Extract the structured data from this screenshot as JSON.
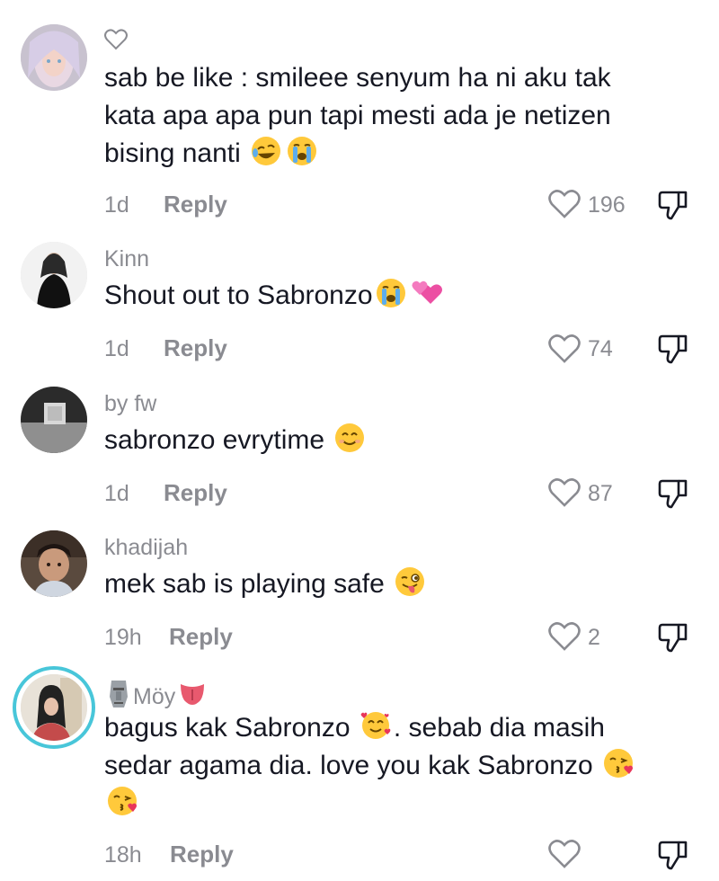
{
  "comments": [
    {
      "username": "",
      "text_parts": [
        "sab be like : smileee senyum ha ni aku tak\nkata apa apa pun tapi mesti ada je netizen\nbising nanti "
      ],
      "emojis": [
        "rofl-emoji",
        "loudly-crying-emoji"
      ],
      "time": "1d",
      "reply_label": "Reply",
      "likes": "196"
    },
    {
      "username": "Kinn",
      "text_parts": [
        "Shout out to Sabronzo"
      ],
      "emojis": [
        "loudly-crying-emoji",
        "two-hearts-emoji"
      ],
      "time": "1d",
      "reply_label": "Reply",
      "likes": "74"
    },
    {
      "username": "by fw",
      "text_parts": [
        "sabronzo evrytime "
      ],
      "emojis": [
        "smiling-emoji"
      ],
      "time": "1d",
      "reply_label": "Reply",
      "likes": "87"
    },
    {
      "username": "khadijah",
      "text_parts": [
        "mek sab is playing safe "
      ],
      "emojis": [
        "winking-tongue-emoji"
      ],
      "time": "19h",
      "reply_label": "Reply",
      "likes": "2"
    },
    {
      "username": "Möy",
      "text_parts": [
        "bagus kak Sabronzo ",
        ". sebab dia masih\nsedar agama dia. love you kak Sabronzo "
      ],
      "emojis": [
        "smiling-hearts-emoji",
        "kissing-heart-emoji",
        "kissing-heart-emoji"
      ],
      "time": "18h",
      "reply_label": "Reply",
      "likes": ""
    }
  ],
  "colors": {
    "text": "#161823",
    "secondary": "#8a8b91",
    "story_ring": "#48c6d9",
    "emoji_yellow": "#ffc93b"
  }
}
